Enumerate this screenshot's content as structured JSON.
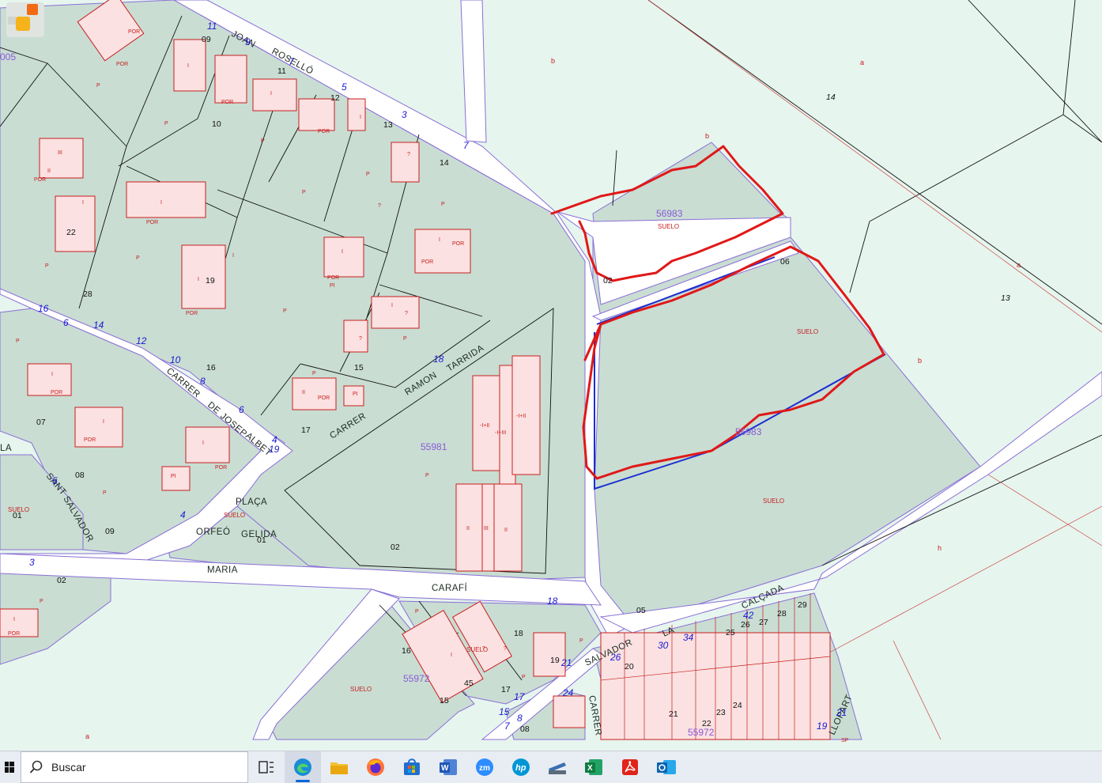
{
  "streets": {
    "joan": "JOAN",
    "rosello": "ROSELLÓ",
    "carrer_josep": "CARRER",
    "de": "DE",
    "josep": "JOSEP",
    "albet": "ALBET",
    "carrer_ramon": "CARRER",
    "ramon": "RAMON",
    "tarrida": "TARRIDA",
    "placa": "PLAÇA",
    "orfeo": "ORFEÓ",
    "gelida": "GELIDA",
    "maria": "MARIA",
    "carafi": "CARAFÍ",
    "sant": "SANT",
    "salvador": "SALVADOR",
    "salvador2": "SALVADOR",
    "la": "LA",
    "calcada": "CALÇADA",
    "carrer_bottom": "CARRER",
    "llopart": "LLOPART",
    "la_left": "LA"
  },
  "parcels": {
    "p1": "56983",
    "p2": "56983",
    "p3": "55981",
    "p4": "55972",
    "p5": "55972",
    "p6": "005"
  },
  "labels": {
    "suelo": "SUELO",
    "por": "POR",
    "pi": "PI",
    "i": "I",
    "ii": "II",
    "iii": "III",
    "p": "P",
    "q": "?",
    "stack1": "-I+II",
    "stack2": "-I+III",
    "sp": "SP"
  },
  "zone_letters": {
    "a": "a",
    "b": "b",
    "h": "h"
  },
  "numbers": {
    "n09": "09",
    "n11": "11",
    "n12": "12",
    "n13": "13",
    "n14": "14",
    "n10": "10",
    "n22": "22",
    "n28": "28",
    "n19": "19",
    "n16": "16",
    "n15": "15",
    "n17": "17",
    "n07": "07",
    "n08": "08",
    "n01": "01",
    "n09b": "09",
    "n02": "02",
    "n02b": "02",
    "n02c": "02",
    "n06": "06",
    "n05": "05",
    "n14z": "14",
    "n13z": "13",
    "n16b": "16",
    "n45": "45",
    "n15b": "15",
    "n18b": "18",
    "n19b": "19",
    "n17b": "17",
    "n08b": "08",
    "n20": "20",
    "n21": "21",
    "n22b": "22",
    "n23": "23",
    "n24b": "24",
    "n25": "25",
    "n26b": "26",
    "n27": "27",
    "n28b": "28",
    "n29": "29",
    "n01b": "01",
    "n02d": "02"
  },
  "block_numbers": {
    "b11": "11",
    "b9": "9",
    "b7": "7",
    "b5": "5",
    "b3": "3",
    "b7b": "7",
    "b16": "16",
    "b6": "6",
    "b14": "14",
    "b12": "12",
    "b10": "10",
    "b8": "8",
    "b6b": "6",
    "b4": "4",
    "b19": "19",
    "b18": "18",
    "b4b": "4",
    "b3b": "3",
    "b5b": "5",
    "b18c": "18",
    "b21": "21",
    "b26": "26",
    "b30": "30",
    "b34": "34",
    "b42": "42",
    "b24": "24",
    "b15": "15",
    "b7c": "7",
    "b8c": "8",
    "b17": "17",
    "b19c": "19",
    "b21c": "21"
  },
  "taskbar": {
    "search_placeholder": "Buscar",
    "apps": [
      "task-view",
      "edge",
      "file-explorer",
      "firefox",
      "store",
      "word",
      "zoom",
      "hp",
      "scanner",
      "excel",
      "acrobat",
      "outlook"
    ]
  },
  "colors": {
    "block": "#c9ddd3",
    "road": "#ffffff",
    "open": "#e6f5ee",
    "building": "#fbe1e1",
    "annotation": "#e01818",
    "selection": "#1b2fd0"
  }
}
